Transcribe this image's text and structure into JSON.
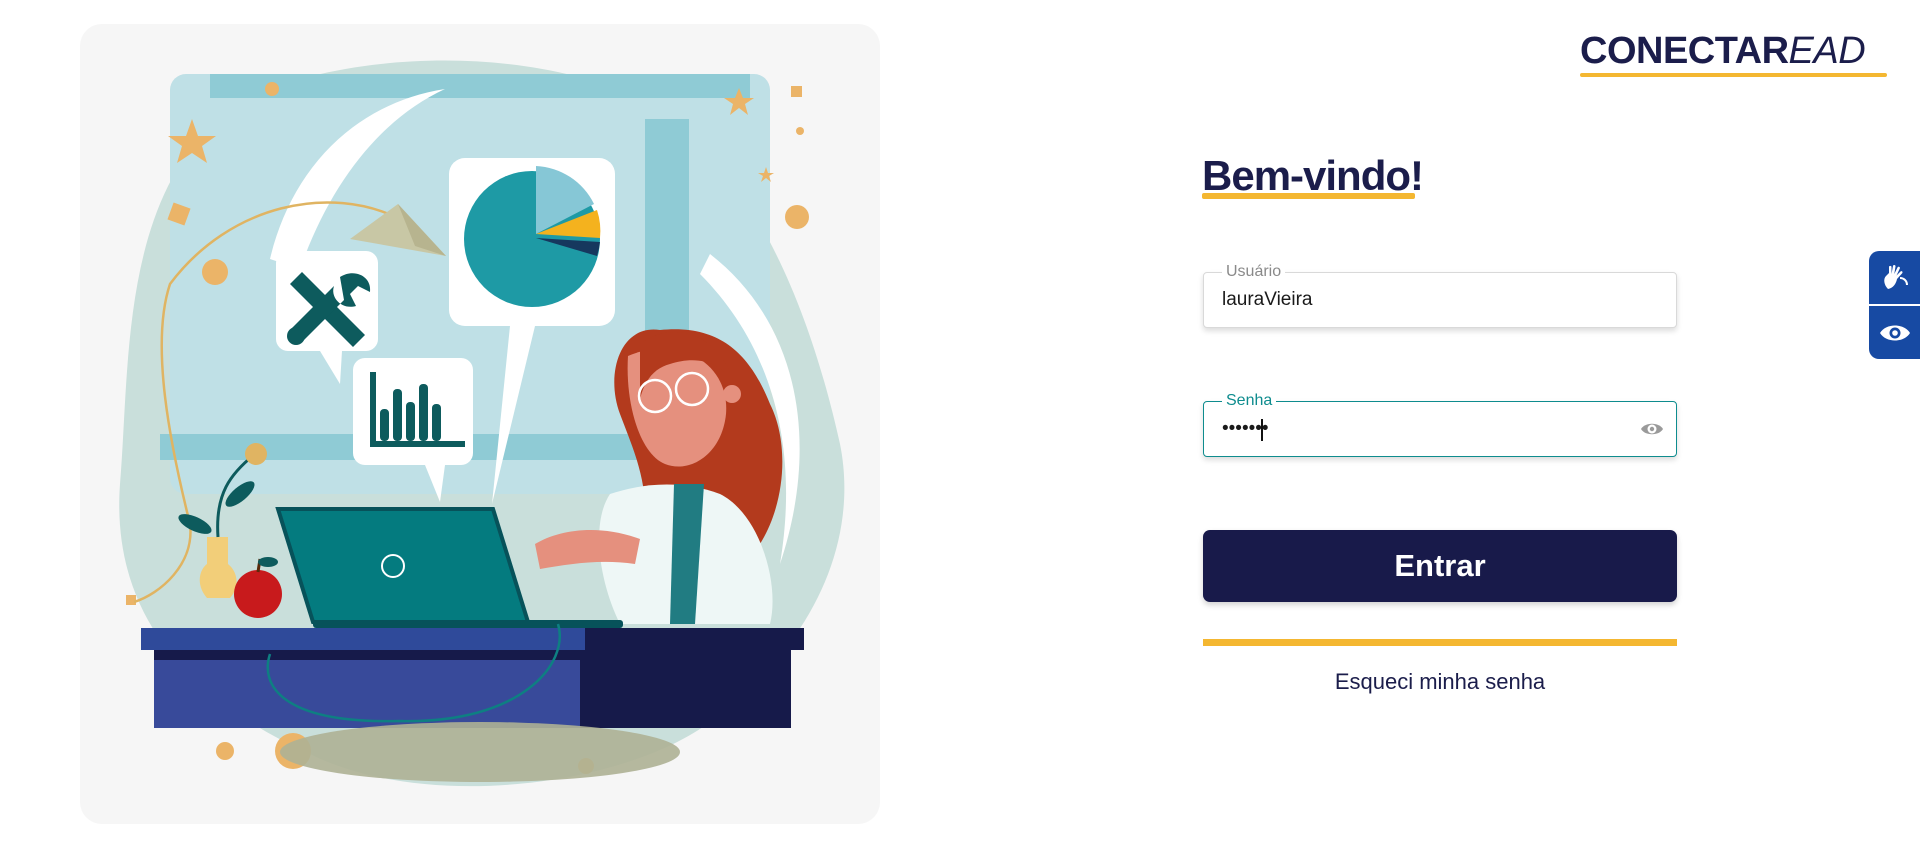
{
  "brand": {
    "logo_bold": "CONECTAR",
    "logo_italic": "EAD",
    "navy": "#1b1d4b",
    "accent": "#f4b731",
    "teal": "#0e8c8e"
  },
  "login": {
    "heading": "Bem-vindo!",
    "username": {
      "label": "Usuário",
      "value": "lauraVieira"
    },
    "password": {
      "label": "Senha",
      "masked_value": "•••••••",
      "toggle_icon": "eye-icon"
    },
    "submit_label": "Entrar",
    "forgot_label": "Esqueci minha senha"
  },
  "accessibility": {
    "color": "#174aa3",
    "buttons": [
      {
        "icon": "sign-language-hand-icon"
      },
      {
        "icon": "eye-icon"
      }
    ]
  },
  "illustration": {
    "subject": "woman-at-laptop-with-charts"
  }
}
